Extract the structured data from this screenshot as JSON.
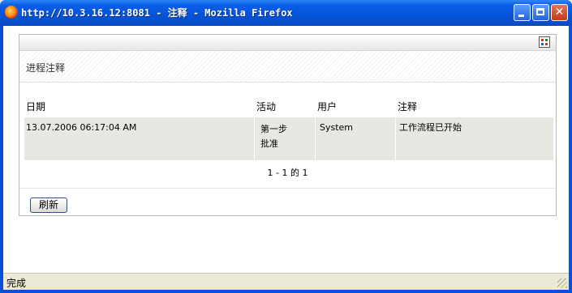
{
  "window": {
    "title": "http://10.3.16.12:8081 - 注释 - Mozilla Firefox",
    "status": "完成"
  },
  "panel": {
    "title": "进程注释",
    "columns": [
      "日期",
      "活动",
      "用户",
      "注释"
    ],
    "rows": [
      {
        "date": "13.07.2006 06:17:04 AM",
        "activity_line1": "第一步",
        "activity_line2": "批准",
        "user": "System",
        "comment": "工作流程已开始"
      }
    ],
    "pager": "1 - 1 的 1",
    "refresh_label": "刷新"
  },
  "icons": {
    "app": "firefox-icon",
    "toolbar": "grid-view-icon",
    "minimize": "minimize-icon",
    "maximize": "maximize-icon",
    "close": "close-icon"
  }
}
